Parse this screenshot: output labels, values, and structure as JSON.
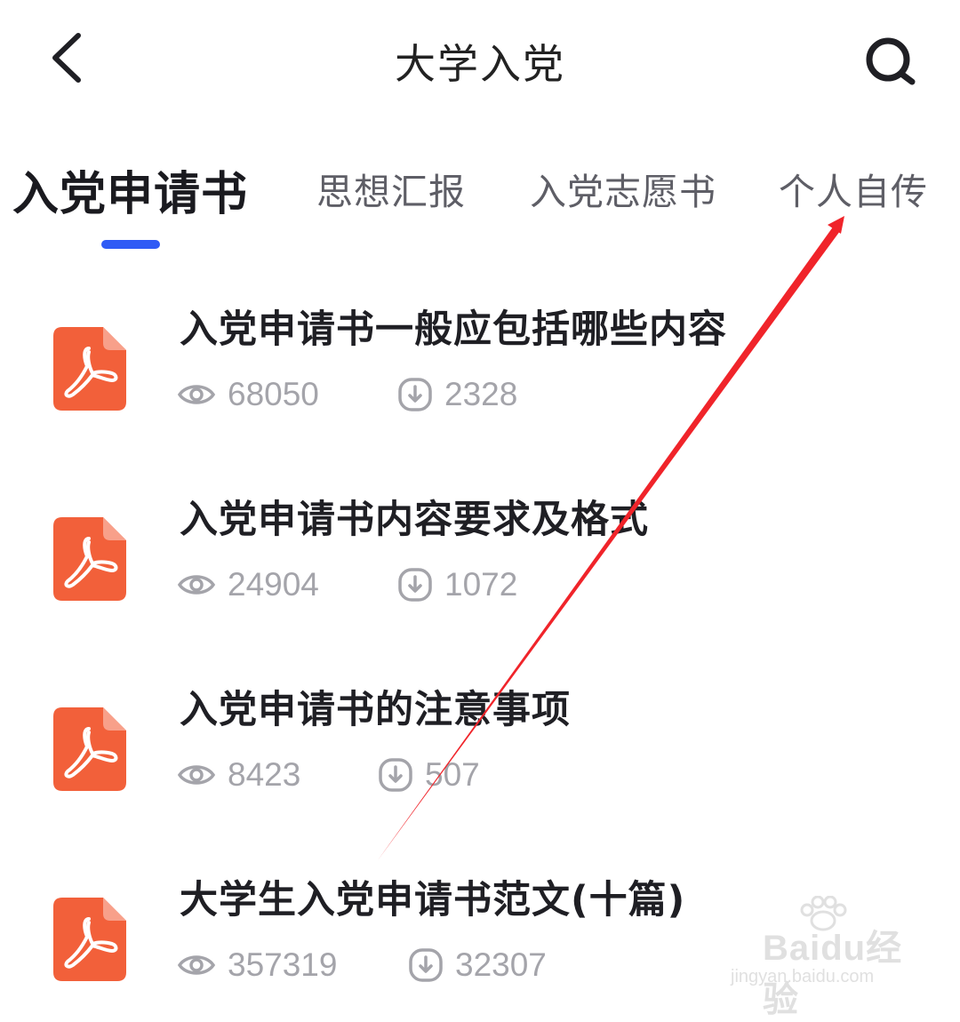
{
  "header": {
    "title": "大学入党",
    "back_icon": "chevron-left-icon",
    "search_icon": "search-icon"
  },
  "tabs": [
    {
      "label": "入党申请书",
      "active": true
    },
    {
      "label": "思想汇报",
      "active": false
    },
    {
      "label": "入党志愿书",
      "active": false
    },
    {
      "label": "个人自传",
      "active": false
    }
  ],
  "documents": [
    {
      "title": "入党申请书一般应包括哪些内容",
      "views": "68050",
      "downloads": "2328"
    },
    {
      "title": "入党申请书内容要求及格式",
      "views": "24904",
      "downloads": "1072"
    },
    {
      "title": "入党申请书的注意事项",
      "views": "8423",
      "downloads": "507"
    },
    {
      "title": "大学生入党申请书范文(十篇)",
      "views": "357319",
      "downloads": "32307"
    }
  ],
  "watermark": {
    "text": "Baidu经验",
    "url": "jingyan.baidu.com"
  },
  "colors": {
    "accent": "#2f5bf5",
    "pdf_icon": "#f2603a",
    "annotation_arrow": "#f0242a"
  }
}
